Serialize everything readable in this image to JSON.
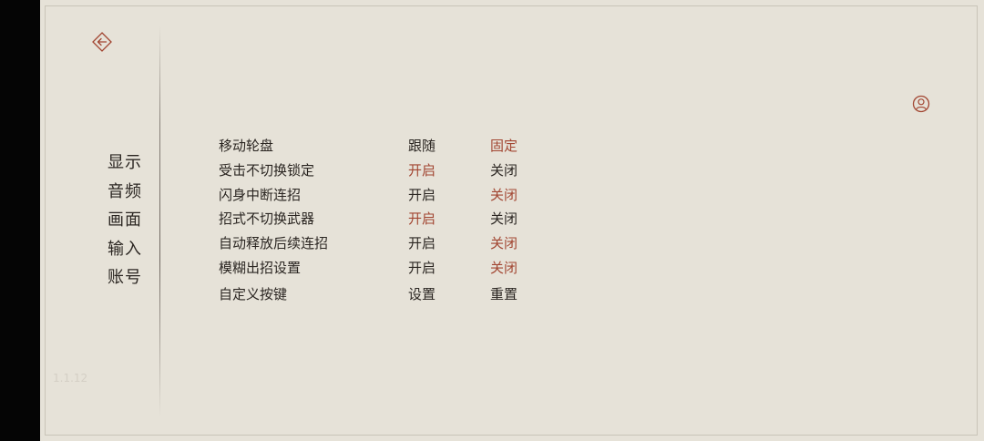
{
  "nav": {
    "items": [
      "显示",
      "音频",
      "画面",
      "输入",
      "账号"
    ],
    "active_index": 3
  },
  "version": "1.1.12",
  "settings": {
    "rows": [
      {
        "label": "移动轮盘",
        "option_a": "跟随",
        "option_b": "固定",
        "selected": "b"
      },
      {
        "label": "受击不切换锁定",
        "option_a": "开启",
        "option_b": "关闭",
        "selected": "a"
      },
      {
        "label": "闪身中断连招",
        "option_a": "开启",
        "option_b": "关闭",
        "selected": "b"
      },
      {
        "label": "招式不切换武器",
        "option_a": "开启",
        "option_b": "关闭",
        "selected": "a"
      },
      {
        "label": "自动释放后续连招",
        "option_a": "开启",
        "option_b": "关闭",
        "selected": "b"
      },
      {
        "label": "模糊出招设置",
        "option_a": "开启",
        "option_b": "关闭",
        "selected": "b"
      },
      {
        "label": "自定义按键",
        "option_a": "设置",
        "option_b": "重置",
        "selected": "none"
      }
    ]
  },
  "icons": {
    "back": "back-arrow-diamond-icon",
    "profile": "user-profile-icon"
  },
  "colors": {
    "background": "#e6e2d8",
    "text": "#2b2622",
    "accent": "#a24632",
    "side_bar": "#050505"
  }
}
